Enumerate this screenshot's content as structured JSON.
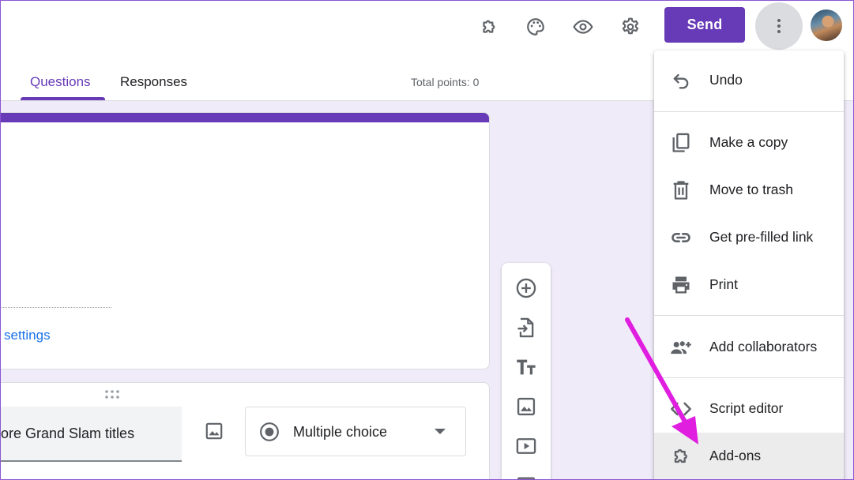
{
  "header": {
    "icons": [
      "add-ons-icon",
      "palette-icon",
      "eye-icon",
      "gear-icon",
      "more-vert-icon"
    ],
    "send_label": "Send"
  },
  "tabs": [
    {
      "label": "Questions",
      "active": true
    },
    {
      "label": "Responses",
      "active": false
    }
  ],
  "total_points": "Total points: 0",
  "title_card": {
    "settings_link": "settings"
  },
  "question": {
    "text": "ore Grand Slam titles",
    "type_label": "Multiple choice"
  },
  "toolbar": {
    "tools": [
      "add-question-icon",
      "import-questions-icon",
      "add-title-icon",
      "add-image-icon",
      "add-video-icon",
      "add-section-icon"
    ]
  },
  "menu": {
    "items": [
      {
        "label": "Undo",
        "icon": "undo-icon"
      },
      {
        "label": "Make a copy",
        "icon": "copy-icon"
      },
      {
        "label": "Move to trash",
        "icon": "trash-icon"
      },
      {
        "label": "Get pre-filled link",
        "icon": "link-icon"
      },
      {
        "label": "Print",
        "icon": "print-icon"
      },
      {
        "label": "Add collaborators",
        "icon": "add-people-icon"
      },
      {
        "label": "Script editor",
        "icon": "code-icon"
      },
      {
        "label": "Add-ons",
        "icon": "add-ons-icon",
        "highlighted": true
      }
    ]
  },
  "colors": {
    "brand": "#673ab7",
    "link": "#1a73e8",
    "background": "#f0ebf8",
    "annotation": "#e01ee0"
  }
}
